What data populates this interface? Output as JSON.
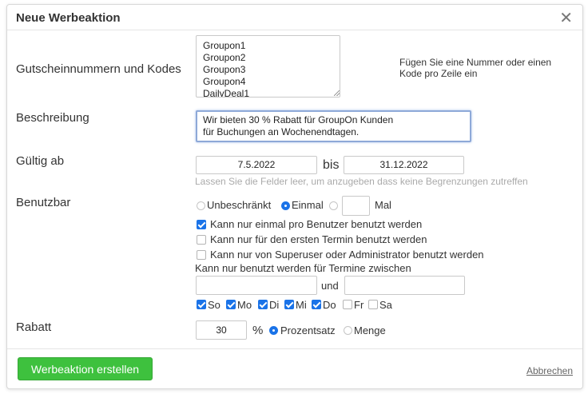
{
  "dialog": {
    "title": "Neue Werbeaktion",
    "close_symbol": "✕"
  },
  "codes": {
    "label": "Gutscheinnummern und Kodes",
    "value": "Groupon1\nGroupon2\nGroupon3\nGroupon4\nDailyDeal1",
    "note": "Fügen Sie eine Nummer oder einen Kode pro Zeile ein"
  },
  "description": {
    "label": "Beschreibung",
    "value": "Wir bieten 30 % Rabatt für GroupOn Kunden\nfür Buchungen an Wochenendtagen."
  },
  "valid": {
    "label": "Gültig ab",
    "from": "7.5.2022",
    "to_label": "bis",
    "to": "31.12.2022",
    "hint": "Lassen Sie die Felder leer, um anzugeben dass keine Begrenzungen zutreffen"
  },
  "usable": {
    "label": "Benutzbar",
    "unlimited": "Unbeschränkt",
    "once": "Einmal",
    "times_value": "",
    "times_label": "Mal",
    "selected": "once",
    "options": [
      {
        "label": "Kann nur einmal pro Benutzer benutzt werden",
        "checked": true
      },
      {
        "label": "Kann nur für den ersten Termin benutzt werden",
        "checked": false
      },
      {
        "label": "Kann nur von Superuser oder Administrator benutzt werden",
        "checked": false
      }
    ],
    "between_label": "Kann nur benutzt werden für Termine zwischen",
    "between_from": "",
    "and_label": "und",
    "between_to": "",
    "days": [
      {
        "label": "So",
        "checked": true
      },
      {
        "label": "Mo",
        "checked": true
      },
      {
        "label": "Di",
        "checked": true
      },
      {
        "label": "Mi",
        "checked": true
      },
      {
        "label": "Do",
        "checked": true
      },
      {
        "label": "Fr",
        "checked": false
      },
      {
        "label": "Sa",
        "checked": false
      }
    ]
  },
  "discount": {
    "label": "Rabatt",
    "value": "30",
    "unit": "%",
    "percent_label": "Prozentsatz",
    "amount_label": "Menge",
    "selected": "percent"
  },
  "footer": {
    "submit": "Werbeaktion erstellen",
    "cancel": "Abbrechen"
  },
  "colors": {
    "accent": "#1a73e8",
    "submit_bg": "#3ec13e",
    "focus_border": "#8ea9d8"
  }
}
